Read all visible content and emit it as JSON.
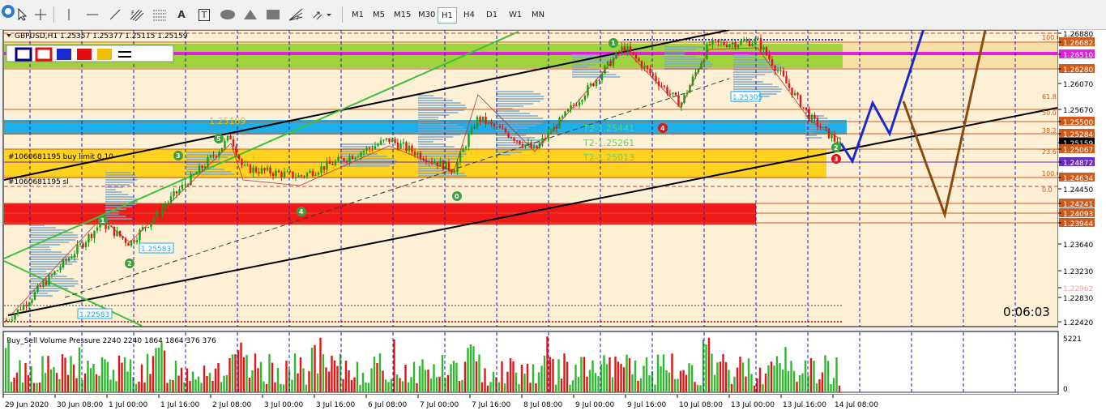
{
  "toolbar": {
    "tools": [
      "cursor-icon",
      "crosshair-icon",
      "vertical-line-icon",
      "horizontal-line-icon",
      "trendline-icon",
      "fibonacci-channel-icon",
      "fibonacci-retracement-icon",
      "text-icon",
      "text-label-icon",
      "ellipse-icon",
      "triangle-icon",
      "rectangle-icon",
      "fibonacci-fan-icon",
      "arrows-dropdown-icon"
    ],
    "text_tool_label": "A",
    "label_tool_label": "T",
    "timeframes": [
      "M1",
      "M5",
      "M15",
      "M30",
      "H1",
      "H4",
      "D1",
      "W1",
      "MN"
    ],
    "active_timeframe": "H1"
  },
  "chart": {
    "symbol_header": "GBPUSD,H1 1.25357 1.25377 1.25115 1.25159",
    "timer": "0:06:03",
    "order_labels": [
      "#1060681195 buy limit 0.10",
      "#1060681195 sl"
    ],
    "annotations": {
      "level_top_left": "1.25169",
      "t2_a": "T2-1.25441",
      "t2_b": "T2-1.25261",
      "t2_c": "T2-1.25013",
      "box_a": "1.25583",
      "box_b": "1.22583",
      "box_c": "1.25305"
    },
    "fib_labels": [
      "100.0",
      "61.8",
      "50.0",
      "38.2",
      "23.6",
      "100.0",
      "0.0"
    ],
    "wave_labels": [
      "1",
      "2",
      "3",
      "4",
      "5",
      "1",
      "2",
      "3",
      "0",
      "4"
    ],
    "colors": {
      "background": "#fdf0d5",
      "zone_cyan": "#1eaee8",
      "zone_yellow": "#ffd21e",
      "zone_red": "#f2181a",
      "zone_green": "#8fd02a",
      "magenta": "#e020e0",
      "bull": "#15a015",
      "bear": "#e01515"
    }
  },
  "price_axis": {
    "labels": [
      "1.26880",
      "1.26682",
      "1.26510",
      "1.26280",
      "1.26070",
      "1.25670",
      "1.25500",
      "1.25284",
      "1.25159",
      "1.25067",
      "1.24872",
      "1.24634",
      "1.24450",
      "1.24241",
      "1.24093",
      "1.23944",
      "1.23640",
      "1.23230",
      "1.22962",
      "1.22830",
      "1.22420"
    ],
    "current_price": "1.25159"
  },
  "time_axis": {
    "labels": [
      "29 Jun 2020",
      "30 Jun 08:00",
      "1 Jul 00:00",
      "1 Jul 16:00",
      "2 Jul 08:00",
      "3 Jul 00:00",
      "3 Jul 16:00",
      "6 Jul 08:00",
      "7 Jul 00:00",
      "7 Jul 16:00",
      "8 Jul 08:00",
      "9 Jul 00:00",
      "9 Jul 16:00",
      "10 Jul 08:00",
      "13 Jul 00:00",
      "13 Jul 16:00",
      "14 Jul 08:00"
    ]
  },
  "indicator": {
    "title": "Buy_Sell Volume Pressure 2240 2240 1864 1864 376 376",
    "scale_top": "5221",
    "scale_zero": "0"
  }
}
